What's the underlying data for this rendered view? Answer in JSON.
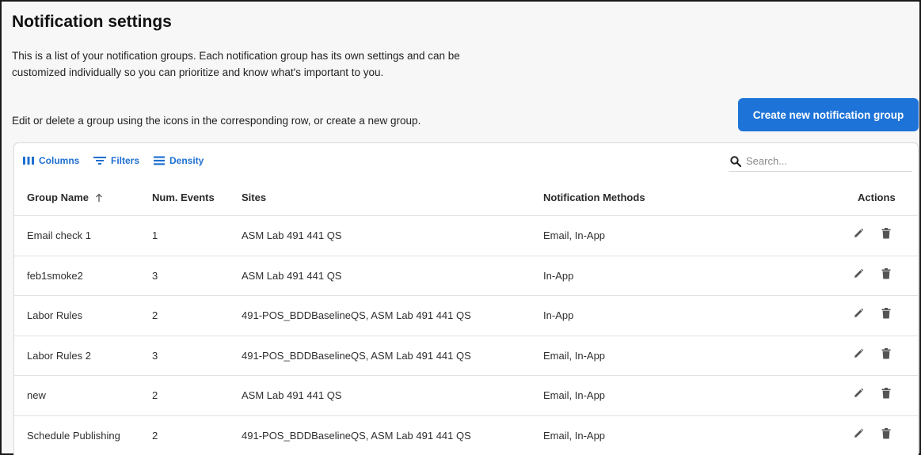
{
  "header": {
    "title": "Notification settings",
    "intro": "This is a list of your notification groups. Each notification group has its own settings and can be customized individually so you can prioritize and know what's important to you.",
    "hint": "Edit or delete a group using the icons in the corresponding row, or create a new group.",
    "create_button": "Create new notification group"
  },
  "toolbar": {
    "columns_label": "Columns",
    "filters_label": "Filters",
    "density_label": "Density",
    "search_placeholder": "Search..."
  },
  "table": {
    "columns": {
      "name": "Group Name",
      "events": "Num. Events",
      "sites": "Sites",
      "methods": "Notification Methods",
      "actions": "Actions"
    },
    "sort": {
      "column": "name",
      "direction": "ascending"
    },
    "rows": [
      {
        "name": "Email check 1",
        "events": "1",
        "sites": "ASM Lab 491 441 QS",
        "methods": "Email, In-App"
      },
      {
        "name": "feb1smoke2",
        "events": "3",
        "sites": "ASM Lab 491 441 QS",
        "methods": "In-App"
      },
      {
        "name": "Labor Rules",
        "events": "2",
        "sites": "491-POS_BDDBaselineQS, ASM Lab 491 441 QS",
        "methods": "In-App"
      },
      {
        "name": "Labor Rules 2",
        "events": "3",
        "sites": "491-POS_BDDBaselineQS, ASM Lab 491 441 QS",
        "methods": "Email, In-App"
      },
      {
        "name": "new",
        "events": "2",
        "sites": "ASM Lab 491 441 QS",
        "methods": "Email, In-App"
      },
      {
        "name": "Schedule Publishing",
        "events": "2",
        "sites": "491-POS_BDDBaselineQS, ASM Lab 491 441 QS",
        "methods": "Email, In-App"
      }
    ],
    "row_actions": [
      "edit-icon",
      "delete-icon"
    ]
  },
  "colors": {
    "accent": "#1e73d8",
    "link": "#1e6fd0",
    "icon": "#555555"
  }
}
